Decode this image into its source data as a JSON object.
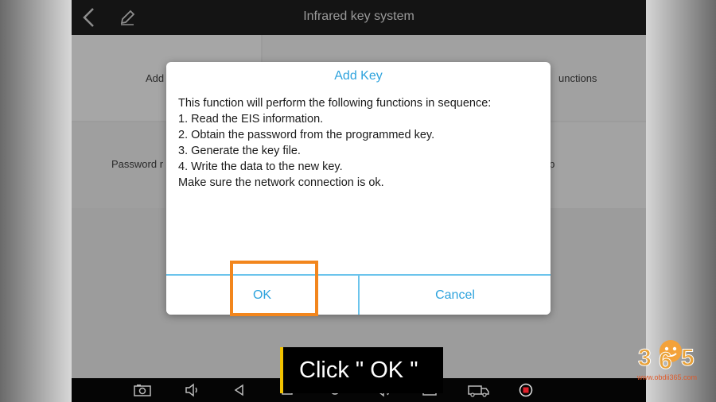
{
  "titlebar": {
    "title": "Infrared key system",
    "back_icon": "back-arrow-icon",
    "edit_icon": "pencil-icon"
  },
  "tiles": [
    {
      "label": "Add"
    },
    {
      "label": "unctions"
    },
    {
      "label": "Password r"
    },
    {
      "label": "elp"
    }
  ],
  "dialog": {
    "title": "Add Key",
    "lines": [
      "This function will perform the following functions in sequence:",
      "1. Read the EIS information.",
      "2. Obtain the password from the programmed key.",
      "3. Generate the key file.",
      "4. Write the data to the new key.",
      "Make sure the network connection is ok."
    ],
    "ok_label": "OK",
    "cancel_label": "Cancel"
  },
  "caption": {
    "text": "Click \" OK \""
  },
  "navbar": {
    "icons": [
      "camera-icon",
      "volume-down-icon",
      "back-icon",
      "home-icon",
      "circle-home-icon",
      "volume-up-icon",
      "screen-mirror-icon",
      "truck-icon",
      "record-icon"
    ]
  },
  "watermark": {
    "url": "www.obdii365.com"
  },
  "colors": {
    "accent": "#2ea3dd",
    "highlight": "#f2861d",
    "caption_bar": "#f2c200",
    "record": "#e0202a"
  }
}
